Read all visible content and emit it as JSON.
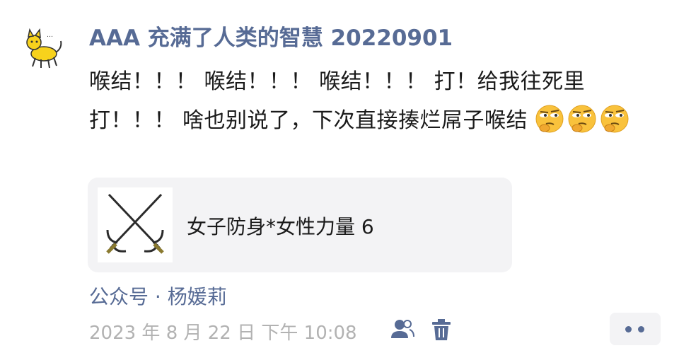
{
  "post": {
    "author": "AAA 充满了人类的智慧 20220901",
    "text": "喉结！！！ 喉结！！！ 喉结！！！ 打！给我往死里打！！！ 啥也别说了，下次直接揍烂屌子喉结",
    "emojis": [
      "thinking-squint-emoji",
      "thinking-squint-emoji",
      "thinking-squint-emoji"
    ],
    "avatar_icon": "yellow-cat-icon"
  },
  "share_card": {
    "title": "女子防身*女性力量 6",
    "thumbnail_icon": "crossed-sai-weapons-icon"
  },
  "source": {
    "label": "公众号 · 杨媛莉"
  },
  "meta": {
    "timestamp": "2023 年 8 月 22 日 下午 10:08"
  },
  "actions": {
    "visibility_icon": "two-person-icon",
    "delete_icon": "trash-icon",
    "more_icon": "two-dots-icon"
  },
  "colors": {
    "link_blue": "#576b95",
    "muted_gray": "#b2b2b2",
    "card_bg": "#f3f3f5"
  }
}
